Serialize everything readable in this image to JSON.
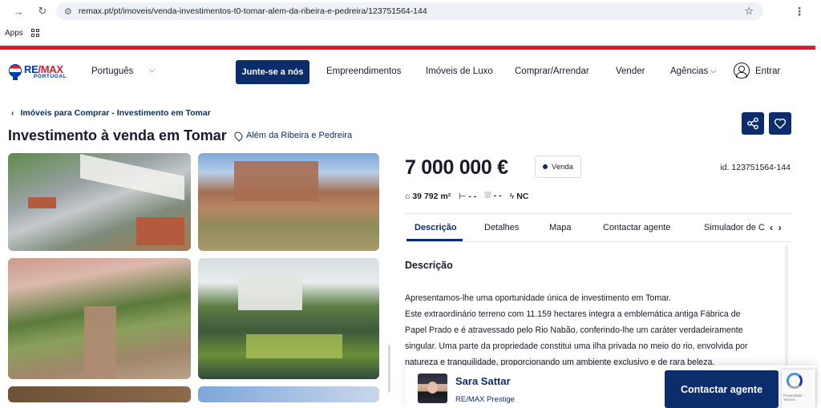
{
  "browser": {
    "url": "remax.pt/pt/imoveis/venda-investimentos-t0-tomar-alem-da-ribeira-e-pedreira/123751564-144",
    "bookmarks_label": "Apps"
  },
  "header": {
    "logo_main": "RE/MAX",
    "logo_sub": "PORTUGAL",
    "language": "Português",
    "join_label": "Junte-se a nós",
    "nav": [
      "Empreendimentos",
      "Imóveis de Luxo",
      "Comprar/Arrendar",
      "Vender",
      "Agências"
    ],
    "login_label": "Entrar",
    "brand_blue": "#0c2d6b",
    "brand_red": "#dc1c2e"
  },
  "listing": {
    "breadcrumb": "Imóveis para Comprar - Investimento em Tomar",
    "title": "Investimento à venda em Tomar",
    "location": "Além da Ribeira e Pedreira",
    "price": "7 000 000 €",
    "status": "Venda",
    "id_label": "id. 123751564-144",
    "specs": {
      "area": "39 792 m²",
      "bedrooms": "- -",
      "bathrooms": "- -",
      "energy": "NC"
    }
  },
  "tabs": [
    "Descrição",
    "Detalhes",
    "Mapa",
    "Contactar agente",
    "Simulador de C"
  ],
  "description": {
    "heading": "Descrição",
    "lines": [
      "Apresentamos-lhe uma oportunidade única de investimento em Tomar.",
      "Este extraordinário terreno com 11.159 hectares integra a emblemática antiga Fábrica de",
      "Papel Prado e é atravessado pelo Rio Nabão, conferindo-lhe um caráter verdadeiramente",
      "singular. Uma parte da propriedade constitui uma ilha privada no meio do rio, envolvida por",
      "natureza e tranquilidade, proporcionando um ambiente exclusivo e de rara beleza."
    ]
  },
  "agent": {
    "name": "Sara Sattar",
    "agency": "RE/MAX Prestige",
    "contact_label": "Contactar agente"
  },
  "recaptcha_text": "Privacidade - Termos"
}
